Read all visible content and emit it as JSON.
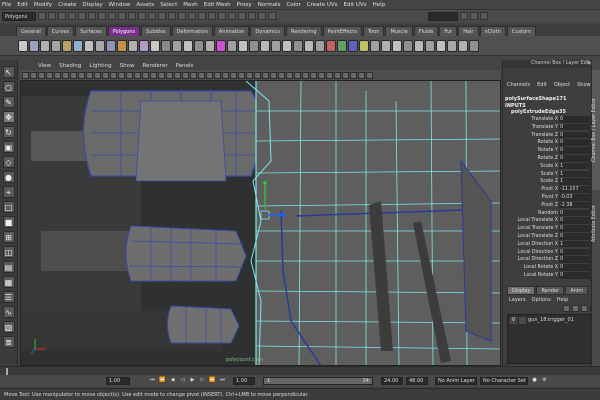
{
  "menubar": [
    "File",
    "Edit",
    "Modify",
    "Create",
    "Display",
    "Window",
    "Assets",
    "Select",
    "Mesh",
    "Edit Mesh",
    "Proxy",
    "Normals",
    "Color",
    "Create UVs",
    "Edit UVs",
    "Help"
  ],
  "status_line": {
    "mode": "Polygons"
  },
  "shelf_tabs": [
    {
      "label": "General",
      "active": false
    },
    {
      "label": "Curves",
      "active": false
    },
    {
      "label": "Surfaces",
      "active": false
    },
    {
      "label": "Polygons",
      "active": true
    },
    {
      "label": "Subdivs",
      "active": false
    },
    {
      "label": "Deformation",
      "active": false
    },
    {
      "label": "Animation",
      "active": false
    },
    {
      "label": "Dynamics",
      "active": false
    },
    {
      "label": "Rendering",
      "active": false
    },
    {
      "label": "PaintEffects",
      "active": false
    },
    {
      "label": "Toon",
      "active": false
    },
    {
      "label": "Muscle",
      "active": false
    },
    {
      "label": "Fluids",
      "active": false
    },
    {
      "label": "Fur",
      "active": false
    },
    {
      "label": "Hair",
      "active": false
    },
    {
      "label": "nCloth",
      "active": false
    },
    {
      "label": "Custom",
      "active": false
    }
  ],
  "shelf_icon_colors": [
    "#c8c8c8",
    "#9aa4c0",
    "#b0b0b0",
    "#a4a4a4",
    "#b8a060",
    "#8cb0d0",
    "#c0c0c0",
    "#a8a8a8",
    "#9090b8",
    "#c89048",
    "#b0b0b0",
    "#b09cc0",
    "#c8c8c8",
    "#8a8a8a",
    "#a0a0a0",
    "#c0c0c0",
    "#909090",
    "#b0b0b0",
    "#d04fd0",
    "#a0a0a0",
    "#c0c0c0",
    "#909090",
    "#b8b8b8",
    "#a0a0a0",
    "#c0c0c0",
    "#909090",
    "#b8b8b8",
    "#a0a0a0",
    "#c06060",
    "#60a060",
    "#6060c0",
    "#c0c060",
    "#a0a0a0",
    "#b0b0b0",
    "#c0c0c0",
    "#909090",
    "#b8b8b8",
    "#a0a0a0",
    "#c0c0c0",
    "#a8a8a8",
    "#b0b0b0",
    "#909090"
  ],
  "panel_menu": [
    "View",
    "Shading",
    "Lighting",
    "Show",
    "Renderer",
    "Panels"
  ],
  "viewport": {
    "watermark": "polycount.com"
  },
  "channel_box": {
    "title": "Channel Box / Layer Editor",
    "menu": [
      "Channels",
      "Edit",
      "Object",
      "Show"
    ],
    "object_name": "polySurfaceShape171",
    "inputs_label": "INPUTS",
    "node_name": "polyExtrudeEdge35",
    "attributes": [
      {
        "label": "Translate X",
        "value": "0"
      },
      {
        "label": "Translate Y",
        "value": "0"
      },
      {
        "label": "Translate Z",
        "value": "0"
      },
      {
        "label": "Rotate X",
        "value": "0"
      },
      {
        "label": "Rotate Y",
        "value": "0"
      },
      {
        "label": "Rotate Z",
        "value": "0"
      },
      {
        "label": "Scale X",
        "value": "1"
      },
      {
        "label": "Scale Y",
        "value": "1"
      },
      {
        "label": "Scale Z",
        "value": "1"
      },
      {
        "label": "Pivot X",
        "value": "-11.157"
      },
      {
        "label": "Pivot Y",
        "value": "-0.03"
      },
      {
        "label": "Pivot Z",
        "value": "-2.38"
      },
      {
        "label": "Random",
        "value": "0"
      },
      {
        "label": "Local Translate X",
        "value": "0"
      },
      {
        "label": "Local Translate Y",
        "value": "0"
      },
      {
        "label": "Local Translate Z",
        "value": "0"
      },
      {
        "label": "Local Direction X",
        "value": "1"
      },
      {
        "label": "Local Direction Y",
        "value": "0"
      },
      {
        "label": "Local Direction Z",
        "value": "0"
      },
      {
        "label": "Local Rotate X",
        "value": "0"
      },
      {
        "label": "Local Rotate Y",
        "value": "0"
      }
    ]
  },
  "side_tabs": {
    "upper": "Channel Box / Layer Editor",
    "lower": "Attribute Editor"
  },
  "layer_editor": {
    "tabs": [
      {
        "label": "Display",
        "active": true
      },
      {
        "label": "Render",
        "active": false
      },
      {
        "label": "Anim",
        "active": false
      }
    ],
    "menu": [
      "Layers",
      "Options",
      "Help"
    ],
    "layer": {
      "visibility": "V",
      "name": "gun_18:trigger_01"
    }
  },
  "time_range": {
    "start": "1.00",
    "start_inner": "1.00",
    "range_start": "1",
    "range_end": "24",
    "end_inner": "24.00",
    "end": "48.00",
    "anim_layer": "No Anim Layer",
    "character_set": "No Character Set"
  },
  "help_line": "Move Tool: Use manipulator to move object(s). Use edit mode to change pivot (INSERT).  Ctrl+LMB to move perpendicular.",
  "colors": {
    "active_tab": "#7a2f8a",
    "wire_cyan": "#7fe6ea",
    "wire_blue": "#2a3a9a",
    "mesh_gray": "#6b6b6b"
  }
}
